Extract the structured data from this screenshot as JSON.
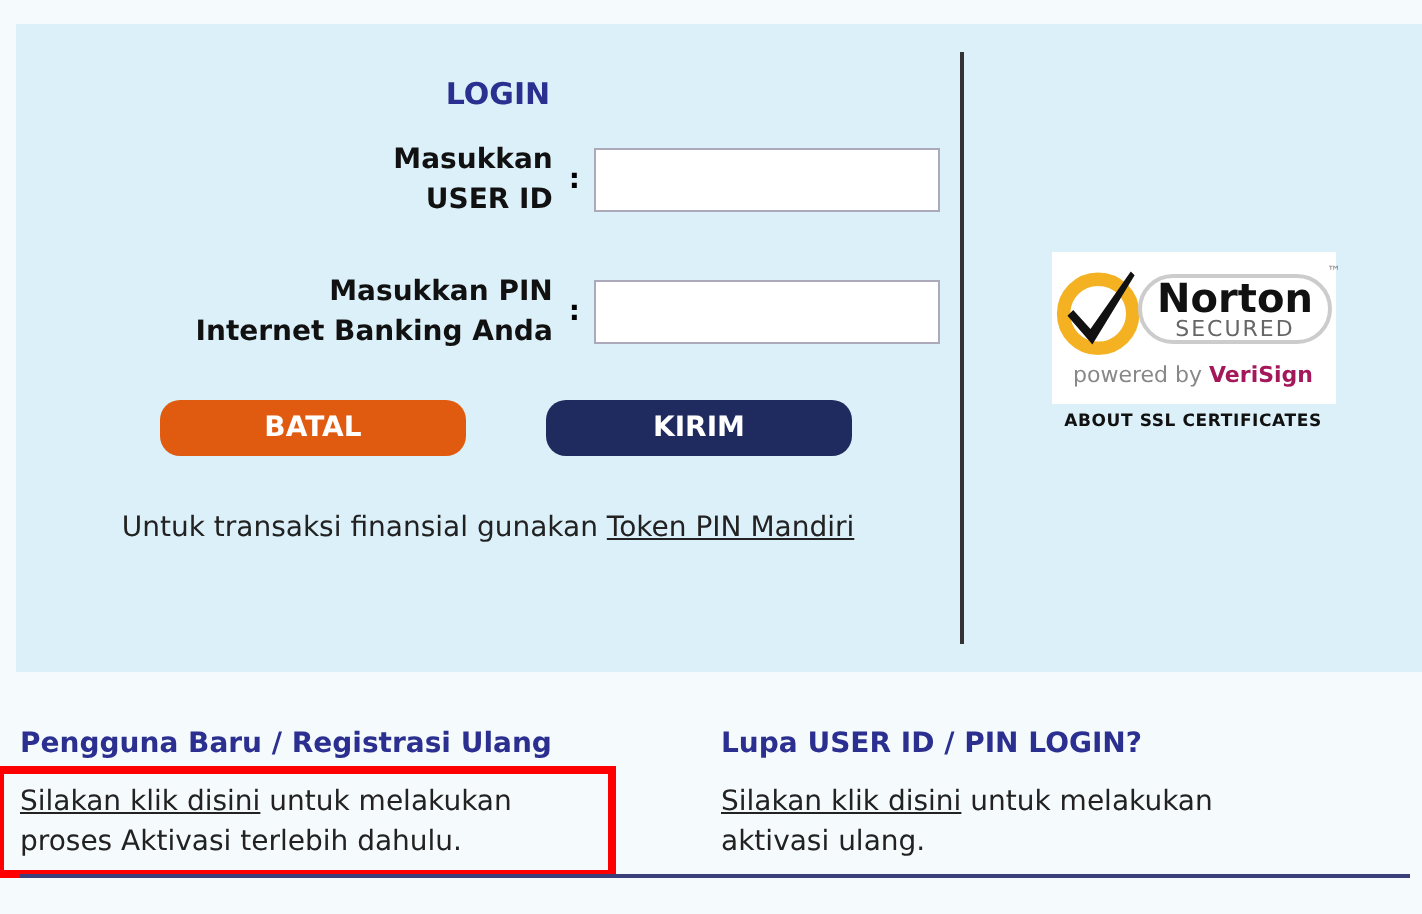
{
  "login": {
    "title": "LOGIN",
    "fields": [
      {
        "label_lines": [
          "Masukkan",
          "USER ID"
        ],
        "separator": ":"
      },
      {
        "label_lines": [
          "Masukkan PIN",
          "Internet Banking Anda"
        ],
        "separator": ":"
      }
    ],
    "buttons": [
      {
        "label": "BATAL",
        "kind": "cancel"
      },
      {
        "label": "KIRIM",
        "kind": "submit"
      }
    ],
    "note": {
      "text": "Untuk transaksi finansial gunakan ",
      "link": "Token PIN Mandiri"
    }
  },
  "badge": {
    "brand": "Norton",
    "secured": "SECURED",
    "powered_by": "powered by",
    "verisign": "VeriSign",
    "trademark": "™",
    "caption": "ABOUT SSL CERTIFICATES"
  },
  "sections": [
    {
      "heading": "Pengguna Baru / Registrasi Ulang",
      "link": "Silakan klik disini",
      "text": " untuk melakukan proses Aktivasi terlebih dahulu.",
      "highlighted": true
    },
    {
      "heading": "Lupa USER ID / PIN LOGIN?",
      "link": "Silakan klik disini",
      "text": " untuk melakukan aktivasi ulang.",
      "highlighted": false
    }
  ]
}
